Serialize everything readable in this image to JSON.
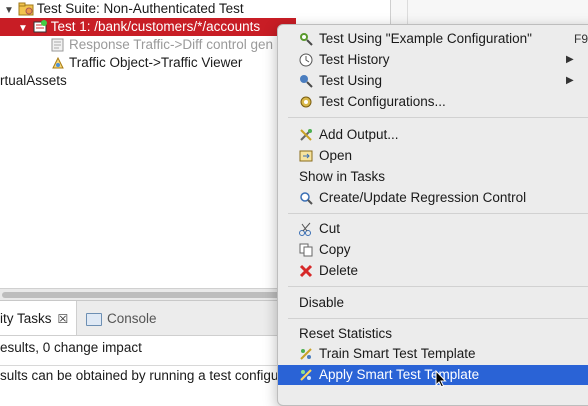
{
  "tree": {
    "suite_label": "Test Suite: Non-Authenticated Test",
    "test1_label": "Test 1: /bank/customers/*/accounts",
    "response_label": "Response Traffic->Diff control gen",
    "traffic_label": "Traffic Object->Traffic Viewer",
    "virtual_label": "rtualAssets"
  },
  "bottom": {
    "tab_tasks": "ity Tasks",
    "tab_close": "☒",
    "tab_console": "Console",
    "line1": "esults, 0 change impact",
    "line2": "sults can be obtained by running a test configuration"
  },
  "menu": {
    "items": [
      {
        "label": "Test Using \"Example Configuration\"",
        "shortcut": "F9",
        "icon": "test-using-icon"
      },
      {
        "label": "Test History",
        "icon": "test-history-icon",
        "submenu": true
      },
      {
        "label": "Test Using",
        "icon": "test-using-submenu-icon",
        "submenu": true
      },
      {
        "label": "Test Configurations...",
        "icon": "test-configurations-icon"
      },
      {
        "label": "Add Output...",
        "icon": "add-output-icon"
      },
      {
        "label": "Open",
        "icon": "open-icon"
      },
      {
        "label": "Show in Tasks"
      },
      {
        "label": "Create/Update Regression Control",
        "icon": "regression-control-icon"
      },
      {
        "label": "Cut",
        "icon": "scissors-icon"
      },
      {
        "label": "Copy",
        "icon": "copy-icon"
      },
      {
        "label": "Delete",
        "icon": "delete-x-icon"
      },
      {
        "label": "Disable"
      },
      {
        "label": "Reset Statistics"
      },
      {
        "label": "Train Smart Test Template",
        "icon": "train-template-icon"
      },
      {
        "label": "Apply Smart Test Template",
        "icon": "apply-template-icon",
        "highlighted": true
      }
    ]
  },
  "colors": {
    "selection_red": "#c81d25",
    "menu_highlight": "#2a63d6"
  }
}
